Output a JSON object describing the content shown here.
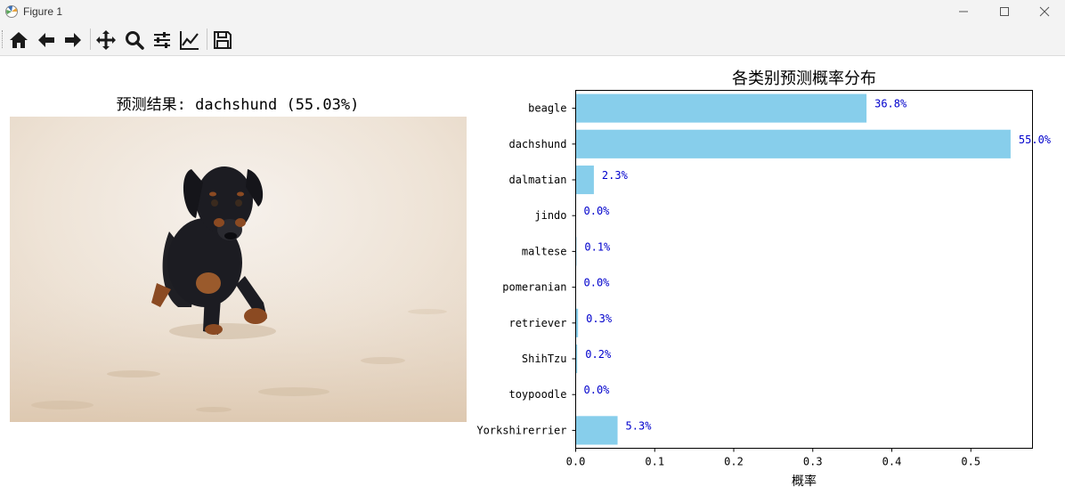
{
  "window": {
    "title": "Figure 1",
    "controls": [
      "minimize",
      "maximize",
      "close"
    ]
  },
  "toolbar": {
    "buttons": [
      "home-icon",
      "back-arrow-icon",
      "forward-arrow-icon",
      "pan-icon",
      "zoom-icon",
      "configure-subplots-icon",
      "edit-axis-icon",
      "save-icon"
    ]
  },
  "left_panel": {
    "title": "预测结果: dachshund (55.03%)",
    "image": "photo of a black-and-tan dachshund puppy running on sand"
  },
  "chart_data": {
    "type": "bar",
    "orientation": "horizontal",
    "title": "各类别预测概率分布",
    "xlabel": "概率",
    "ylabel": "",
    "categories": [
      "beagle",
      "dachshund",
      "dalmatian",
      "jindo",
      "maltese",
      "pomeranian",
      "retriever",
      "ShihTzu",
      "toypoodle",
      "Yorkshirerrier"
    ],
    "values": [
      0.368,
      0.5503,
      0.023,
      0.0,
      0.001,
      0.0,
      0.003,
      0.002,
      0.0,
      0.053
    ],
    "labels": [
      "36.8%",
      "55.0%",
      "2.3%",
      "0.0%",
      "0.1%",
      "0.0%",
      "0.3%",
      "0.2%",
      "0.0%",
      "5.3%"
    ],
    "xticks": [
      "0.0",
      "0.1",
      "0.2",
      "0.3",
      "0.4",
      "0.5"
    ],
    "xlim": [
      0,
      0.578
    ],
    "bar_color": "#87ceeb",
    "label_color": "#0000cc"
  }
}
